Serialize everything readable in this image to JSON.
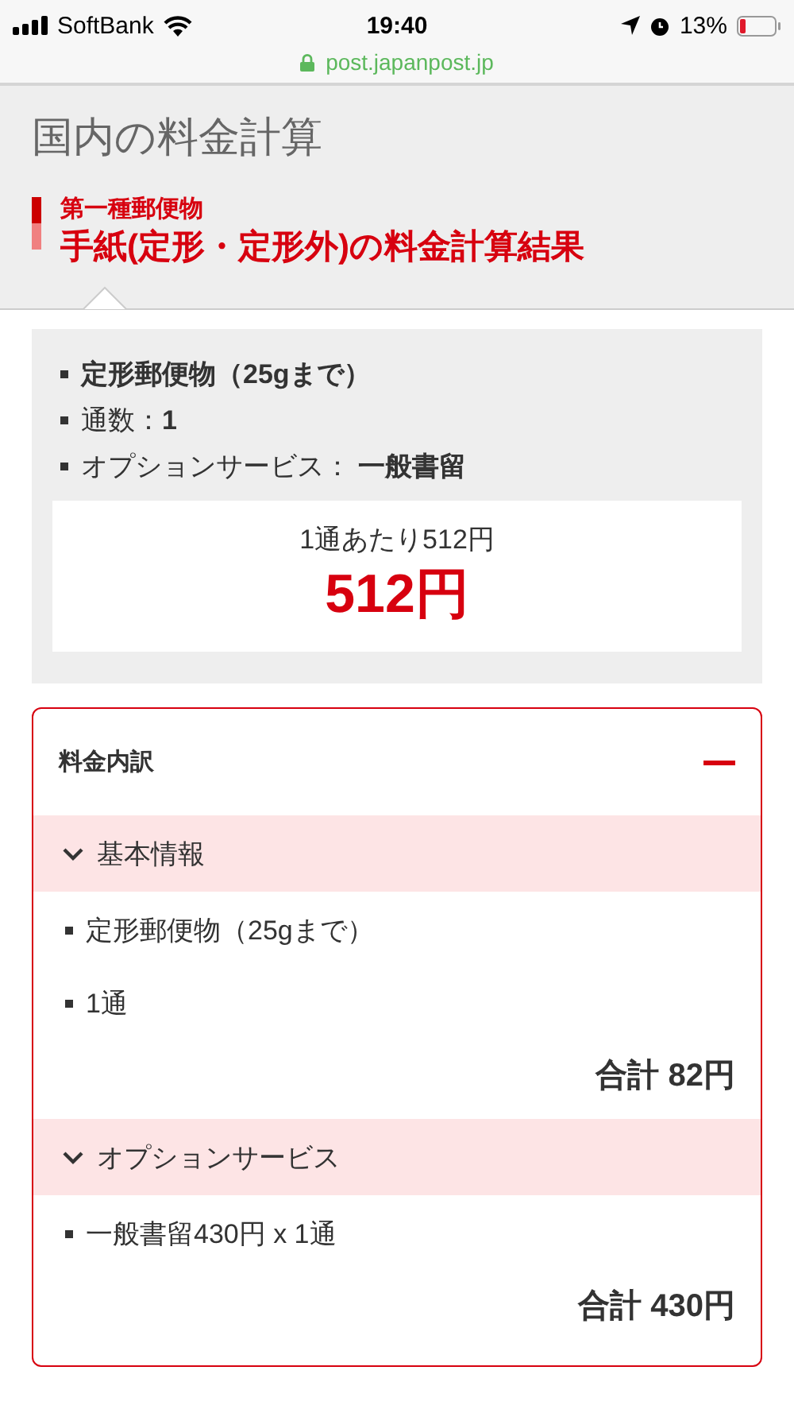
{
  "status_bar": {
    "carrier": "SoftBank",
    "time": "19:40",
    "battery": "13%",
    "url": "post.japanpost.jp"
  },
  "page_title": "国内の料金計算",
  "heading": {
    "category": "第一種郵便物",
    "title": "手紙(定形・定形外)の料金計算結果"
  },
  "summary": {
    "items": [
      {
        "value": "定形郵便物（25gまで）"
      },
      {
        "label": "通数：",
        "value": "1"
      },
      {
        "label": "オプションサービス： ",
        "value": "一般書留"
      }
    ],
    "per_item": "1通あたり512円",
    "total": "512円"
  },
  "breakdown": {
    "title": "料金内訳",
    "expanded": true,
    "sections": [
      {
        "title": "基本情報",
        "expanded": true,
        "items": [
          "定形郵便物（25gまで）",
          "1通"
        ],
        "total": "合計 82円"
      },
      {
        "title": "オプションサービス",
        "expanded": true,
        "items": [
          "一般書留430円 x 1通"
        ],
        "total": "合計 430円"
      }
    ]
  }
}
